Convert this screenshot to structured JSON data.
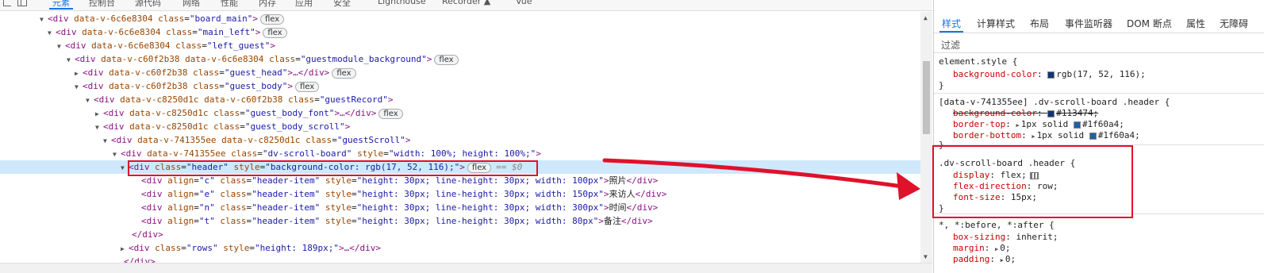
{
  "toolbar": {
    "tabs": [
      "元素",
      "控制台",
      "源代码",
      "网络",
      "性能",
      "内存",
      "应用",
      "安全",
      "Lighthouse",
      "Recorder ▲",
      "Vue"
    ],
    "active_tab": "元素"
  },
  "dom_lines": [
    {
      "tri": "▼",
      "open": "<div",
      "attrs": [
        {
          "n": "data-v-6c6e8304"
        },
        {
          "n": "class",
          "v": "\"board_main\""
        }
      ],
      "close": ">",
      "badge": "flex"
    },
    {
      "tri": "▼",
      "open": "<div",
      "attrs": [
        {
          "n": "data-v-6c6e8304"
        },
        {
          "n": "class",
          "v": "\"main_left\""
        }
      ],
      "close": ">",
      "badge": "flex"
    },
    {
      "tri": "▼",
      "open": "<div",
      "attrs": [
        {
          "n": "data-v-6c6e8304"
        },
        {
          "n": "class",
          "v": "\"left_guest\""
        }
      ],
      "close": ">"
    },
    {
      "tri": "▼",
      "open": "<div",
      "attrs": [
        {
          "n": "data-v-c60f2b38"
        },
        {
          "n": "data-v-6c6e8304"
        },
        {
          "n": "class",
          "v": "\"guestmodule_background\""
        }
      ],
      "close": ">",
      "badge": "flex"
    },
    {
      "tri": "▶",
      "open": "<div",
      "attrs": [
        {
          "n": "data-v-c60f2b38"
        },
        {
          "n": "class",
          "v": "\"guest_head\""
        }
      ],
      "close": ">…</div>",
      "badge": "flex"
    },
    {
      "tri": "▼",
      "open": "<div",
      "attrs": [
        {
          "n": "data-v-c60f2b38"
        },
        {
          "n": "class",
          "v": "\"guest_body\""
        }
      ],
      "close": ">",
      "badge": "flex"
    },
    {
      "tri": "▼",
      "open": "<div",
      "attrs": [
        {
          "n": "data-v-c8250d1c"
        },
        {
          "n": "data-v-c60f2b38"
        },
        {
          "n": "class",
          "v": "\"guestRecord\""
        }
      ],
      "close": ">"
    },
    {
      "tri": "▶",
      "open": "<div",
      "attrs": [
        {
          "n": "data-v-c8250d1c"
        },
        {
          "n": "class",
          "v": "\"guest_body_font\""
        }
      ],
      "close": ">…</div>",
      "badge": "flex"
    },
    {
      "tri": "▼",
      "open": "<div",
      "attrs": [
        {
          "n": "data-v-c8250d1c"
        },
        {
          "n": "class",
          "v": "\"guest_body_scroll\""
        }
      ],
      "close": ">"
    },
    {
      "tri": "▼",
      "open": "<div",
      "attrs": [
        {
          "n": "data-v-741355ee"
        },
        {
          "n": "data-v-c8250d1c"
        },
        {
          "n": "class",
          "v": "\"guestScroll\""
        }
      ],
      "close": ">"
    },
    {
      "tri": "▼",
      "open": "<div",
      "attrs": [
        {
          "n": "data-v-741355ee"
        },
        {
          "n": "class",
          "v": "\"dv-scroll-board\""
        },
        {
          "n": "style",
          "v": "\"width: 100%; height: 100%;\""
        }
      ],
      "close": ">"
    },
    {
      "tri": "▼",
      "open": "<div",
      "attrs": [
        {
          "n": "class",
          "v": "\"header\""
        },
        {
          "n": "style",
          "v": "\"background-color: rgb(17, 52, 116);\""
        }
      ],
      "close": ">",
      "badge": "flex",
      "eq": "== $0",
      "selected": true
    },
    {
      "tri": "",
      "open": "<div",
      "attrs": [
        {
          "n": "align",
          "v": "\"c\""
        },
        {
          "n": "class",
          "v": "\"header-item\""
        },
        {
          "n": "style",
          "v": "\"height: 30px; line-height: 30px; width: 100px\""
        }
      ],
      "close": ">",
      "text": "照片",
      "end": "</div>"
    },
    {
      "tri": "",
      "open": "<div",
      "attrs": [
        {
          "n": "align",
          "v": "\"e\""
        },
        {
          "n": "class",
          "v": "\"header-item\""
        },
        {
          "n": "style",
          "v": "\"height: 30px; line-height: 30px; width: 150px\""
        }
      ],
      "close": ">",
      "text": "来访人",
      "end": "</div>"
    },
    {
      "tri": "",
      "open": "<div",
      "attrs": [
        {
          "n": "align",
          "v": "\"n\""
        },
        {
          "n": "class",
          "v": "\"header-item\""
        },
        {
          "n": "style",
          "v": "\"height: 30px; line-height: 30px; width: 300px\""
        }
      ],
      "close": ">",
      "text": "时间",
      "end": "</div>"
    },
    {
      "tri": "",
      "open": "<div",
      "attrs": [
        {
          "n": "align",
          "v": "\"t\""
        },
        {
          "n": "class",
          "v": "\"header-item\""
        },
        {
          "n": "style",
          "v": "\"height: 30px; line-height: 30px; width: 80px\""
        }
      ],
      "close": ">",
      "text": "备注",
      "end": "</div>"
    },
    {
      "tri": "",
      "open": "</div>",
      "attrs": [],
      "close": ""
    },
    {
      "tri": "▶",
      "open": "<div",
      "attrs": [
        {
          "n": "class",
          "v": "\"rows\""
        },
        {
          "n": "style",
          "v": "\"height: 189px;\""
        }
      ],
      "close": ">…</div>"
    },
    {
      "tri": "",
      "open": "</div>",
      "attrs": [],
      "close": ""
    }
  ],
  "styles": {
    "tabs": [
      "样式",
      "计算样式",
      "布局",
      "事件监听器",
      "DOM 断点",
      "属性",
      "无障碍"
    ],
    "active_tab": "样式",
    "filter_placeholder": "过滤",
    "rule1": {
      "selector": "element.style {",
      "prop": "background-color",
      "value": "rgb(17, 52, 116);",
      "color": "#113474",
      "end": "}"
    },
    "rule2": {
      "selector": "[data-v-741355ee] .dv-scroll-board .header {",
      "decls": [
        {
          "prop": "background-color",
          "value": "#113474;",
          "color": "#113474",
          "struck": true
        },
        {
          "prop": "border-top",
          "value": "1px solid ",
          "value2": "#1f60a4;",
          "color": "#1f60a4",
          "arrow": true
        },
        {
          "prop": "border-bottom",
          "value": "1px solid ",
          "value2": "#1f60a4;",
          "color": "#1f60a4",
          "arrow": true
        }
      ],
      "end": "}"
    },
    "rule3": {
      "selector": ".dv-scroll-board .header {",
      "decls": [
        {
          "prop": "display",
          "value": "flex;"
        },
        {
          "prop": "flex-direction",
          "value": "row;"
        },
        {
          "prop": "font-size",
          "value": "15px;"
        }
      ],
      "end": "}"
    },
    "rule4": {
      "selector": "*, *:before, *:after {",
      "decls": [
        {
          "prop": "box-sizing",
          "value": "inherit;"
        },
        {
          "prop": "margin",
          "value": "0;"
        },
        {
          "prop": "padding",
          "value": "0;"
        }
      ]
    }
  },
  "accent_color": "#1a73e8",
  "annotation_color": "#e0112b"
}
